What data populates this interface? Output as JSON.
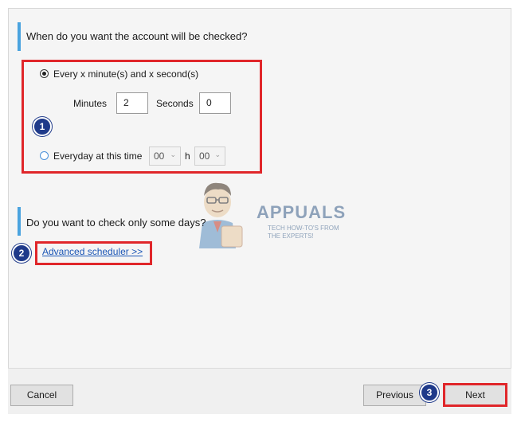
{
  "schedule": {
    "question": "When do you want the account will be checked?",
    "interval_option_label": "Every x minute(s) and x second(s)",
    "minutes_label": "Minutes",
    "minutes_value": "2",
    "seconds_label": "Seconds",
    "seconds_value": "0",
    "daily_option_label": "Everyday at this time",
    "hour_value": "00",
    "hour_separator": "h",
    "minute_value": "00"
  },
  "days": {
    "question": "Do you want to check only some days?",
    "advanced_link": "Advanced scheduler >>"
  },
  "badges": [
    "1",
    "2",
    "3"
  ],
  "watermark": {
    "brand": "APPUALS",
    "tagline_1": "TECH HOW-TO'S FROM",
    "tagline_2": "THE EXPERTS!"
  },
  "footer": {
    "cancel_label": "Cancel",
    "previous_label": "Previous",
    "next_label": "Next"
  },
  "colors": {
    "accent_bar": "#4aa3df",
    "highlight_red": "#e0262a",
    "badge_blue": "#1f3a8a",
    "link_blue": "#1a55b5"
  }
}
